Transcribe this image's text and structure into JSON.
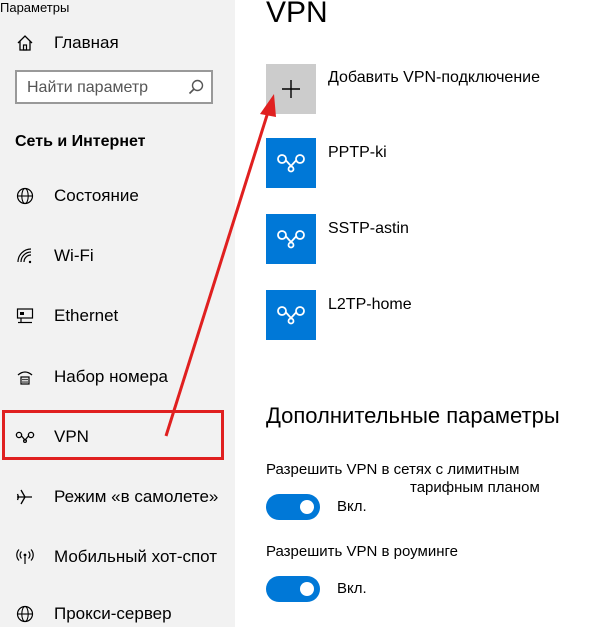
{
  "app": {
    "title": "Параметры"
  },
  "sidebar": {
    "home_label": "Главная",
    "search": {
      "placeholder": "Найти параметр"
    },
    "section_title": "Сеть и Интернет",
    "items": [
      {
        "label": "Состояние",
        "icon": "globe-icon"
      },
      {
        "label": "Wi-Fi",
        "icon": "wifi-icon"
      },
      {
        "label": "Ethernet",
        "icon": "ethernet-icon"
      },
      {
        "label": "Набор номера",
        "icon": "dialup-icon"
      },
      {
        "label": "VPN",
        "icon": "vpn-icon"
      },
      {
        "label": "Режим «в самолете»",
        "icon": "airplane-icon"
      },
      {
        "label": "Мобильный хот-спот",
        "icon": "hotspot-icon"
      },
      {
        "label": "Прокси-сервер",
        "icon": "globe-icon"
      }
    ]
  },
  "main": {
    "title": "VPN",
    "add_label": "Добавить VPN-подключение",
    "connections": [
      {
        "name": "PPTP-ki"
      },
      {
        "name": "SSTP-astin"
      },
      {
        "name": "L2TP-home"
      }
    ],
    "advanced": {
      "title": "Дополнительные параметры",
      "metered_label_line1": "Разрешить VPN в сетях с лимитным",
      "metered_label_line2": "тарифным планом",
      "metered_state": "Вкл.",
      "roaming_label": "Разрешить VPN в роуминге",
      "roaming_state": "Вкл."
    }
  },
  "colors": {
    "accent": "#0078d7",
    "highlight": "#e02020",
    "sidebar_bg": "#f2f2f2"
  }
}
